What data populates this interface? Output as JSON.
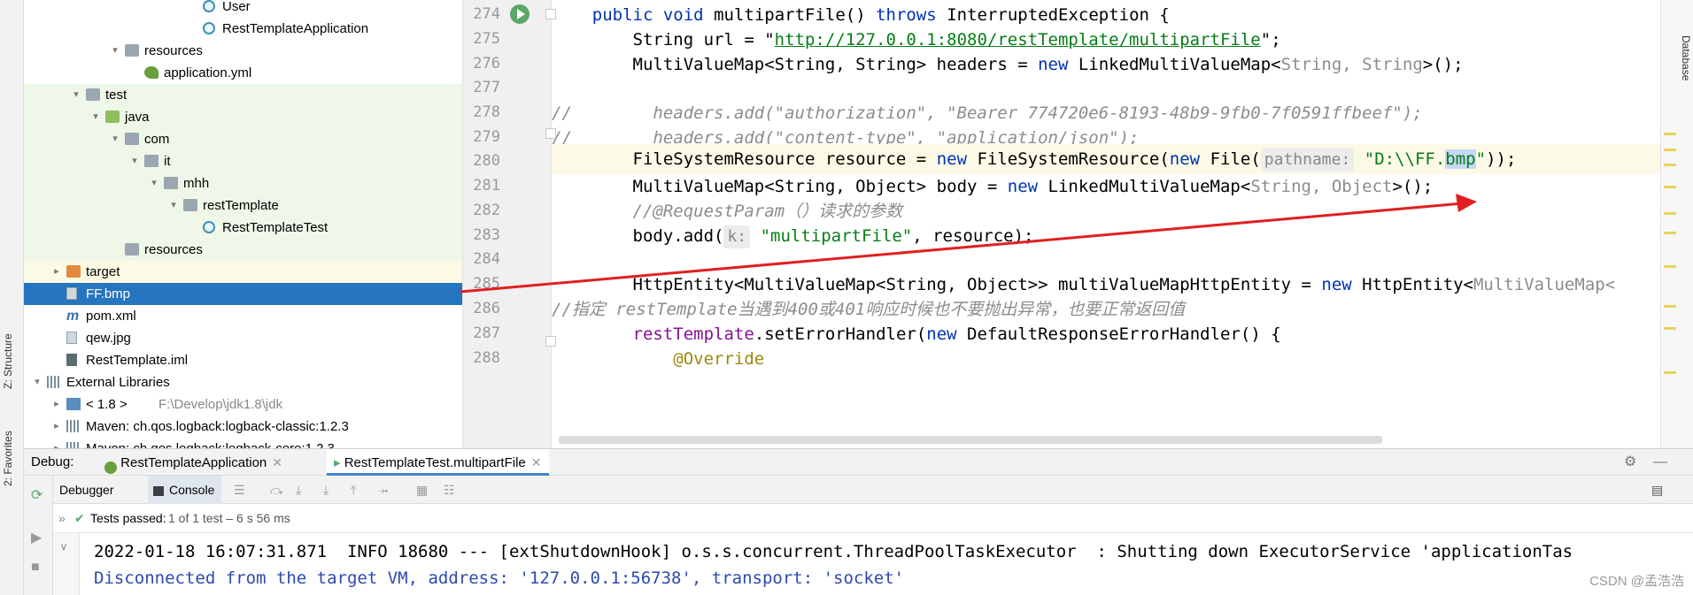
{
  "left_strip": {
    "structure": "Z: Structure",
    "favorites": "2: Favorites"
  },
  "tree": [
    {
      "label": "User",
      "icon": "class-icon",
      "depth": 8,
      "arrow": ""
    },
    {
      "label": "RestTemplateApplication",
      "icon": "class-icon",
      "depth": 8,
      "arrow": ""
    },
    {
      "label": "resources",
      "icon": "resources-folder-icon",
      "depth": 4,
      "arrow": "v"
    },
    {
      "label": "application.yml",
      "icon": "yaml-file-icon",
      "depth": 5,
      "arrow": ""
    },
    {
      "label": "test",
      "icon": "folder-icon",
      "depth": 2,
      "arrow": "v"
    },
    {
      "label": "java",
      "icon": "test-folder-icon",
      "depth": 3,
      "arrow": "v"
    },
    {
      "label": "com",
      "icon": "package-icon",
      "depth": 4,
      "arrow": "v"
    },
    {
      "label": "it",
      "icon": "package-icon",
      "depth": 5,
      "arrow": "v"
    },
    {
      "label": "mhh",
      "icon": "package-icon",
      "depth": 6,
      "arrow": "v"
    },
    {
      "label": "restTemplate",
      "icon": "package-icon",
      "depth": 7,
      "arrow": "v"
    },
    {
      "label": "RestTemplateTest",
      "icon": "class-icon",
      "depth": 8,
      "arrow": ""
    },
    {
      "label": "resources",
      "icon": "resources-folder-icon",
      "depth": 4,
      "arrow": ""
    },
    {
      "label": "target",
      "icon": "excluded-folder-icon",
      "depth": 1,
      "arrow": ">"
    },
    {
      "label": "FF.bmp",
      "icon": "image-file-icon",
      "depth": 1,
      "arrow": ""
    },
    {
      "label": "pom.xml",
      "icon": "maven-icon",
      "depth": 1,
      "arrow": ""
    },
    {
      "label": "qew.jpg",
      "icon": "image-file-icon",
      "depth": 1,
      "arrow": ""
    },
    {
      "label": "RestTemplate.iml",
      "icon": "module-file-icon",
      "depth": 1,
      "arrow": ""
    },
    {
      "label": "External Libraries",
      "icon": "libraries-icon",
      "depth": 0,
      "arrow": "v"
    },
    {
      "label": "< 1.8 >",
      "sub": "F:\\Develop\\jdk1.8\\jdk",
      "icon": "jdk-icon",
      "depth": 1,
      "arrow": ">"
    },
    {
      "label": "Maven: ch.qos.logback:logback-classic:1.2.3",
      "icon": "library-icon",
      "depth": 1,
      "arrow": ">"
    },
    {
      "label": "Maven: ch.qos.logback:logback-core:1.2.3",
      "icon": "library-icon",
      "depth": 1,
      "arrow": ">"
    }
  ],
  "editor": {
    "line_numbers": [
      "274",
      "275",
      "276",
      "277",
      "278",
      "279",
      "280",
      "281",
      "282",
      "283",
      "284",
      "285",
      "286",
      "287",
      "288"
    ],
    "l274": {
      "kw1": "public",
      "kw2": "void",
      "name": "multipartFile() ",
      "kw3": "throws",
      "rest": " InterruptedException {"
    },
    "l275": {
      "a": "String url = \"",
      "url": "http://127.0.0.1:8080/restTemplate/multipartFile",
      "b": "\";"
    },
    "l276": {
      "a": "MultiValueMap<String, String> headers = ",
      "kw": "new",
      "b": " LinkedMultiValueMap<",
      "gray": "String, String",
      "c": ">();"
    },
    "l278": "//        headers.add(\"authorization\", \"Bearer 774720e6-8193-48b9-9fb0-7f0591ffbeef\");",
    "l279": "//        headers.add(\"content-type\", \"application/json\");",
    "l280": {
      "a": "FileSystemResource resource = ",
      "kw1": "new",
      "b": " FileSystemResource(",
      "kw2": "new",
      "c": " File(",
      "hint": "pathname:",
      "s1": "\"D:\\\\FF.",
      "sel": "bmp",
      "s2": "\"",
      "d": "));"
    },
    "l281": {
      "a": "MultiValueMap<String, Object> body = ",
      "kw": "new",
      "b": " LinkedMultiValueMap<",
      "gray": "String, Object",
      "c": ">();"
    },
    "l282": "//@RequestParam（）读求的参数",
    "l283": {
      "a": "body.add(",
      "hint": "k:",
      "str": "\"multipartFile\"",
      "b": ", resource);"
    },
    "l285": {
      "a": "HttpEntity<MultiValueMap<String, Object>> multiValueMapHttpEntity = ",
      "kw": "new",
      "b": " HttpEntity<",
      "gray": "MultiValueMap<"
    },
    "l286": "//指定 restTemplate当遇到400或401响应时候也不要抛出异常，也要正常返回值",
    "l287": {
      "fld": "restTemplate",
      "a": ".setErrorHandler(",
      "kw": "new",
      "b": " DefaultResponseErrorHandler() {"
    },
    "l288": "@Override"
  },
  "right_strip": {
    "database": "Database"
  },
  "debug": {
    "label": "Debug:",
    "tab1": "RestTemplateApplication",
    "tab2": "RestTemplateTest.multipartFile",
    "debugger_tab": "Debugger",
    "console_tab": "Console",
    "tests_passed": "Tests passed:",
    "tests_detail": "1 of 1 test – 6 s 56 ms",
    "console_lines": [
      "2022-01-18 16:07:31.871  INFO 18680 --- [extShutdownHook] o.s.s.concurrent.ThreadPoolTaskExecutor  : Shutting down ExecutorService 'applicationTas",
      "Disconnected from the target VM, address: '127.0.0.1:56738', transport: 'socket'"
    ]
  },
  "watermark": "CSDN @孟浩浩",
  "colors": {
    "selection": "#2675bf",
    "test_folder_bg": "#eff7e9",
    "arrow": "#e02020",
    "keyword": "#0033b3",
    "string": "#067d17"
  }
}
